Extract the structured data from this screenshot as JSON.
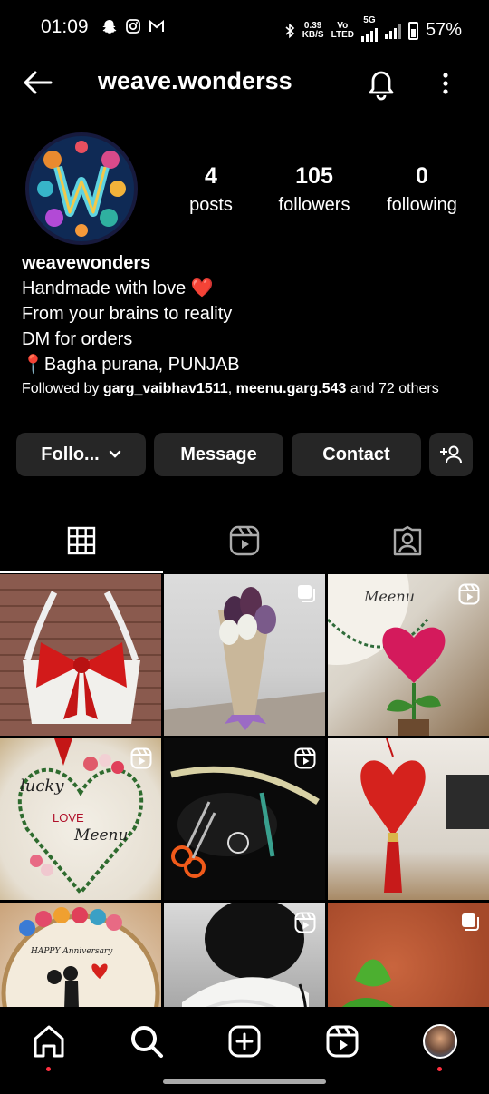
{
  "status_bar": {
    "time": "01:09",
    "net_speed_top": "0.39",
    "net_speed_bottom": "KB/S",
    "volte_top": "Vo",
    "volte_bottom": "LTED",
    "network": "5G",
    "battery": "57%"
  },
  "header": {
    "username": "weave.wonderss"
  },
  "profile": {
    "stats": [
      {
        "value": "4",
        "label": "posts"
      },
      {
        "value": "105",
        "label": "followers"
      },
      {
        "value": "0",
        "label": "following"
      }
    ],
    "name": "weavewonders",
    "bio_lines": [
      "Handmade with love ❤️",
      "From your brains to reality",
      "DM for orders",
      "📍Bagha purana, PUNJAB"
    ],
    "followed_by": {
      "prefix": "Followed by ",
      "user1": "garg_vaibhav1511",
      "sep": ", ",
      "user2": "meenu.garg.543",
      "suffix": " and 72 others"
    }
  },
  "actions": {
    "follow_label": "Follo...",
    "message_label": "Message",
    "contact_label": "Contact"
  },
  "tabs": [
    "grid",
    "reels",
    "tagged"
  ],
  "posts": [
    {
      "icon": "none"
    },
    {
      "icon": "carousel-icon"
    },
    {
      "icon": "reel-icon"
    },
    {
      "icon": "reel-icon"
    },
    {
      "icon": "reel-icon"
    },
    {
      "icon": "none"
    },
    {
      "icon": "none"
    },
    {
      "icon": "reel-icon"
    },
    {
      "icon": "carousel-icon"
    }
  ],
  "colors": {
    "background": "#000000",
    "button_bg": "#262626",
    "accent_red": "#ff3040"
  }
}
